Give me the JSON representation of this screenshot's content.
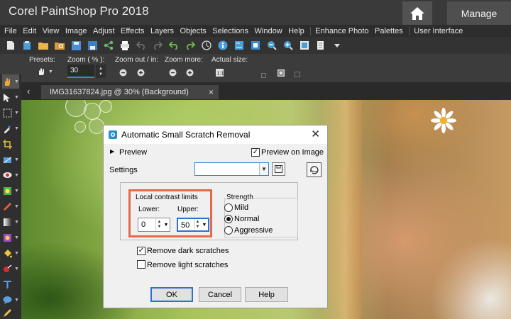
{
  "app": {
    "title": "Corel PaintShop Pro 2018",
    "manage_tab": "Manage"
  },
  "menu": [
    "File",
    "Edit",
    "View",
    "Image",
    "Adjust",
    "Effects",
    "Layers",
    "Objects",
    "Selections",
    "Window",
    "Help",
    "Enhance Photo",
    "Palettes",
    "User Interface"
  ],
  "tool_options": {
    "presets_label": "Presets:",
    "zoom_label": "Zoom ( % ):",
    "zoom_value": "30",
    "zoom_out_in_label": "Zoom out / in:",
    "zoom_more_label": "Zoom more:",
    "actual_size_label": "Actual size:"
  },
  "document": {
    "tab_label": "IMG31637824.jpg @  30% (Background)",
    "close_glyph": "×"
  },
  "dialog": {
    "title": "Automatic Small Scratch Removal",
    "preview_label": "Preview",
    "preview_on_image_label": "Preview on Image",
    "preview_on_image_checked": true,
    "settings_label": "Settings",
    "settings_value": "",
    "local_contrast_label": "Local contrast limits",
    "lower_label": "Lower:",
    "lower_value": "0",
    "upper_label": "Upper:",
    "upper_value": "50",
    "strength_label": "Strength",
    "strength_options": [
      "Mild",
      "Normal",
      "Aggressive"
    ],
    "strength_selected": "Normal",
    "remove_dark_label": "Remove dark scratches",
    "remove_dark_checked": true,
    "remove_light_label": "Remove light scratches",
    "remove_light_checked": false,
    "ok_label": "OK",
    "cancel_label": "Cancel",
    "help_label": "Help",
    "close_glyph": "✕"
  },
  "colors": {
    "highlight": "#e36a4a",
    "focus": "#2f6fcf",
    "app_bg": "#2b2b2b"
  }
}
